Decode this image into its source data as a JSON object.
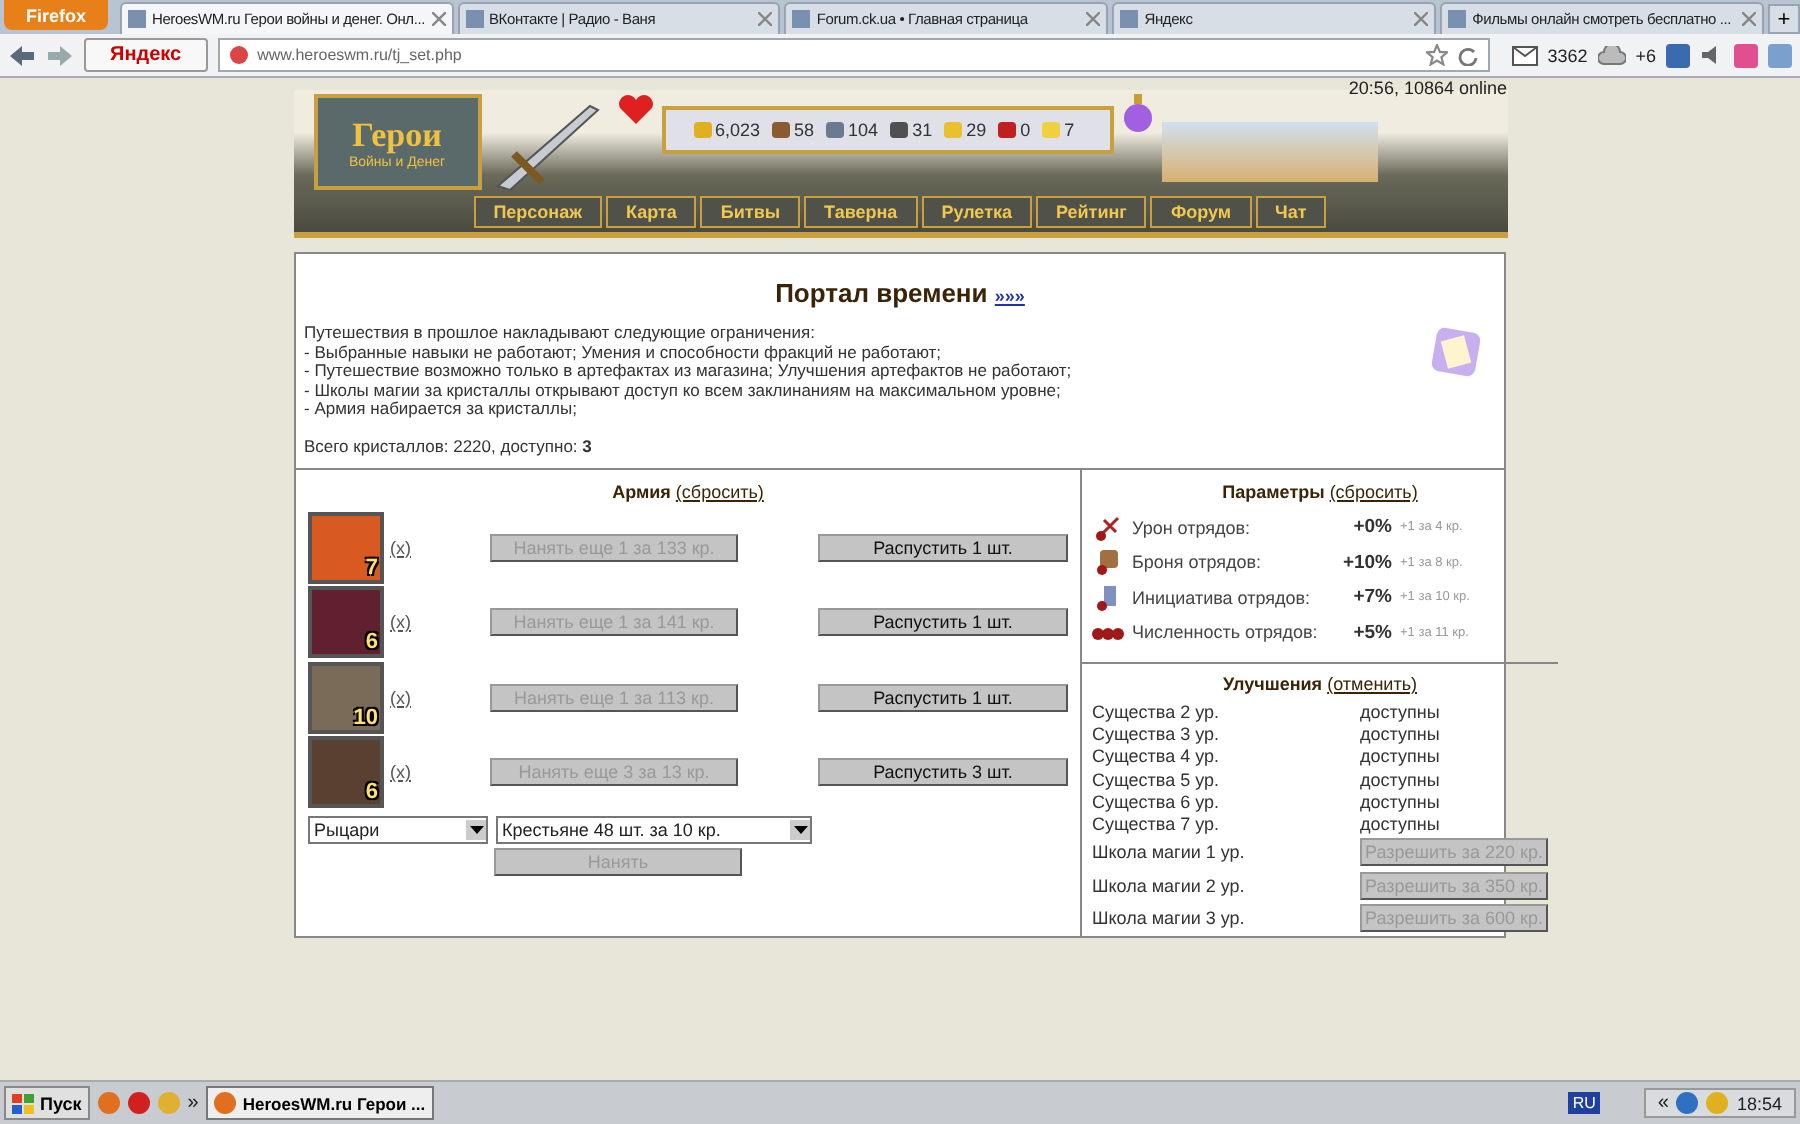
{
  "browser": {
    "menu_button": "Firefox",
    "tabs": [
      {
        "title": "HeroesWM.ru Герои войны и денег. Онл...",
        "selected": true
      },
      {
        "title": "ВКонтакте | Радио - Ваня",
        "selected": false
      },
      {
        "title": "Forum.ck.ua • Главная страница",
        "selected": false
      },
      {
        "title": "Яндекс",
        "selected": false
      },
      {
        "title": "Фильмы онлайн смотреть бесплатно ...",
        "selected": false
      }
    ],
    "new_tab": "+",
    "search_brand": "Яндекс",
    "url": "www.heroeswm.ru/tj_set.php",
    "mail_count": "3362",
    "weather": "+6"
  },
  "header": {
    "logo_title": "Герои",
    "logo_subtitle": "Войны и Денег",
    "resources": [
      "6,023",
      "58",
      "104",
      "31",
      "29",
      "0",
      "7"
    ],
    "status": "20:56, 10864 online",
    "nav": [
      "Персонаж",
      "Карта",
      "Битвы",
      "Таверна",
      "Рулетка",
      "Рейтинг",
      "Форум",
      "Чат"
    ]
  },
  "portal": {
    "title": "Портал времени",
    "link": "»»»",
    "intro": "Путешествия в прошлое накладывают следующие ограничения:",
    "rules": [
      "- Выбранные навыки не работают; Умения и способности фракций не работают;",
      "- Путешествие возможно только в артефактах из магазина; Улучшения артефактов не работают;",
      "- Школы магии за кристаллы открывают доступ ко всем заклинаниям на максимальном уровне;",
      "- Армия набирается за кристаллы;"
    ],
    "total": "Всего кристаллов: 2220, доступно: **3**"
  },
  "army": {
    "title": "Армия",
    "reset": "(сбросить)",
    "units": [
      {
        "level": "7",
        "remove": "(x)",
        "hire": "Нанять еще 1 за 133 кр.",
        "hire_disabled": true,
        "dismiss": "Распустить 1 шт."
      },
      {
        "level": "6",
        "remove": "(x)",
        "hire": "Нанять еще 1 за 141 кр.",
        "hire_disabled": true,
        "dismiss": "Распустить 1 шт."
      },
      {
        "level": "10",
        "remove": "(x)",
        "hire": "Нанять еще 1 за 113 кр.",
        "hire_disabled": true,
        "dismiss": "Распустить 1 шт."
      },
      {
        "level": "6",
        "remove": "(x)",
        "hire": "Нанять еще 3 за 13 кр.",
        "hire_disabled": true,
        "dismiss": "Распустить 3 шт."
      }
    ],
    "faction": "Рыцари",
    "creature": "Крестьяне 48 шт. за 10 кр.",
    "hire_button": "Нанять",
    "hire_button_disabled": true
  },
  "params": {
    "title": "Параметры",
    "reset": "(сбросить)",
    "items": [
      {
        "label": "Урон отрядов:",
        "value": "+0%",
        "cost": "+1 за 4 кр."
      },
      {
        "label": "Броня отрядов:",
        "value": "+10%",
        "cost": "+1 за 8 кр."
      },
      {
        "label": "Инициатива отрядов:",
        "value": "+7%",
        "cost": "+1 за 10 кр."
      },
      {
        "label": "Численность отрядов:",
        "value": "+5%",
        "cost": "+1 за 11 кр."
      }
    ]
  },
  "upgrades": {
    "title": "Улучшения",
    "cancel": "(отменить)",
    "items": [
      {
        "kind": "status",
        "label": "Существа 2 ур.",
        "status": "доступны"
      },
      {
        "kind": "status",
        "label": "Существа 3 ур.",
        "status": "доступны"
      },
      {
        "kind": "status",
        "label": "Существа 4 ур.",
        "status": "доступны"
      },
      {
        "kind": "status",
        "label": "Существа 5 ур.",
        "status": "доступны"
      },
      {
        "kind": "status",
        "label": "Существа 6 ур.",
        "status": "доступны"
      },
      {
        "kind": "status",
        "label": "Существа 7 ур.",
        "status": "доступны"
      },
      {
        "kind": "button",
        "label": "Школа магии 1 ур.",
        "button": "Разрешить за 220 кр.",
        "disabled": true
      },
      {
        "kind": "button",
        "label": "Школа магии 2 ур.",
        "button": "Разрешить за 350 кр.",
        "disabled": true
      },
      {
        "kind": "button",
        "label": "Школа магии 3 ур.",
        "button": "Разрешить за 600 кр.",
        "disabled": true
      }
    ]
  },
  "taskbar": {
    "start": "Пуск",
    "more": "»",
    "task": "HeroesWM.ru Герои ...",
    "language": "RU",
    "tray_more": "«",
    "clock": "18:54"
  }
}
